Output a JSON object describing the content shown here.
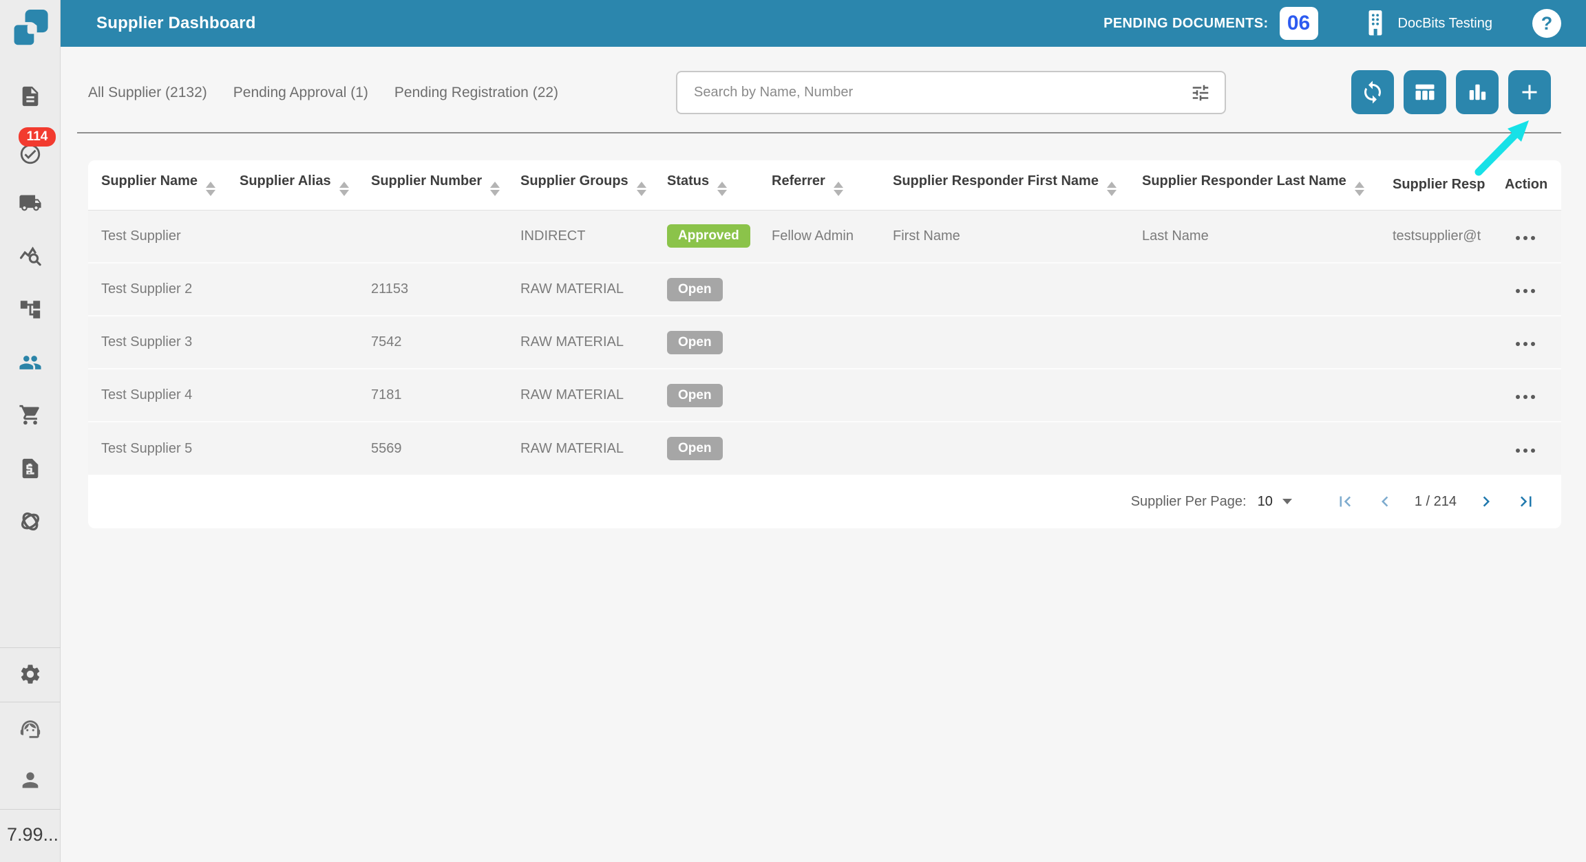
{
  "app": {
    "title": "Supplier Dashboard"
  },
  "topbar": {
    "pending_documents_label": "PENDING DOCUMENTS:",
    "pending_documents_count": "06",
    "organization": "DocBits Testing",
    "help": "?"
  },
  "sidebar": {
    "badge_count": "114",
    "version": "7.99...",
    "icons": [
      "document",
      "approvals-check",
      "shipping-truck",
      "analytics-search",
      "workflow-tree",
      "suppliers-people",
      "shopping-cart",
      "invoice-dollar",
      "integrations-orbit",
      "settings-gear",
      "support-headset",
      "profile-person"
    ],
    "active_icon": "suppliers-people"
  },
  "tabs": {
    "all": "All Supplier (2132)",
    "pending_approval": "Pending Approval (1)",
    "pending_registration": "Pending Registration (22)"
  },
  "search": {
    "placeholder": "Search by Name, Number"
  },
  "toolbar": {
    "icons": [
      "refresh-sync",
      "table-columns",
      "bar-chart",
      "add-plus"
    ]
  },
  "table": {
    "columns": {
      "name": "Supplier Name",
      "alias": "Supplier Alias",
      "number": "Supplier Number",
      "groups": "Supplier Groups",
      "status": "Status",
      "referrer": "Referrer",
      "responder_first": "Supplier Responder First Name",
      "responder_last": "Supplier Responder Last Name",
      "responder_email_truncated": "Supplier Resp",
      "action": "Action"
    },
    "rows": [
      {
        "name": "Test Supplier",
        "alias": "",
        "number": "",
        "groups": "INDIRECT",
        "status": "Approved",
        "referrer": "Fellow Admin",
        "responder_first": "First Name",
        "responder_last": "Last Name",
        "responder_email": "testsupplier@t"
      },
      {
        "name": "Test Supplier 2",
        "alias": "",
        "number": "21153",
        "groups": "RAW MATERIAL",
        "status": "Open",
        "referrer": "",
        "responder_first": "",
        "responder_last": "",
        "responder_email": ""
      },
      {
        "name": "Test Supplier 3",
        "alias": "",
        "number": "7542",
        "groups": "RAW MATERIAL",
        "status": "Open",
        "referrer": "",
        "responder_first": "",
        "responder_last": "",
        "responder_email": ""
      },
      {
        "name": "Test Supplier 4",
        "alias": "",
        "number": "7181",
        "groups": "RAW MATERIAL",
        "status": "Open",
        "referrer": "",
        "responder_first": "",
        "responder_last": "",
        "responder_email": ""
      },
      {
        "name": "Test Supplier 5",
        "alias": "",
        "number": "5569",
        "groups": "RAW MATERIAL",
        "status": "Open",
        "referrer": "",
        "responder_first": "",
        "responder_last": "",
        "responder_email": ""
      }
    ]
  },
  "pagination": {
    "per_page_label": "Supplier Per Page:",
    "per_page_value": "10",
    "page_info": "1 / 214"
  },
  "colors": {
    "accent_teal": "#2b86ad",
    "status_approved": "#8bc34a",
    "status_open": "#a6a6a6",
    "alert_red": "#f23b2f",
    "pending_count_blue": "#2d5bf0",
    "pointer_cyan": "#17e1e7"
  }
}
